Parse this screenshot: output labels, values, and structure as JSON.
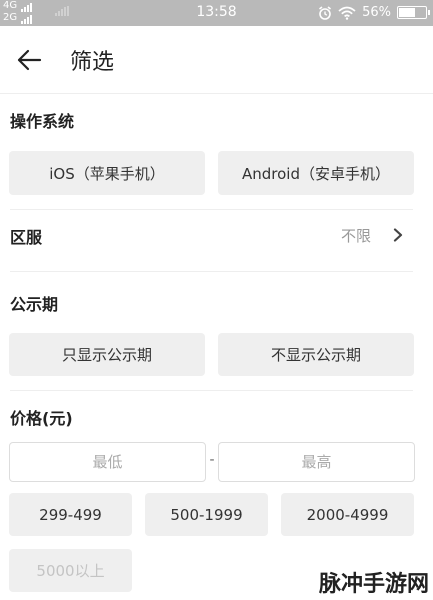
{
  "status_bar": {
    "net1": "4G",
    "net2": "2G",
    "time": "13:58",
    "battery_text": "56%",
    "battery_level": 0.56
  },
  "nav": {
    "title": "筛选",
    "back_icon": "arrow-left"
  },
  "os_section": {
    "title": "操作系统",
    "options": [
      "iOS（苹果手机）",
      "Android（安卓手机）"
    ]
  },
  "region": {
    "label": "区服",
    "value": "不限",
    "chevron_icon": "chevron-right"
  },
  "publicity_section": {
    "title": "公示期",
    "options": [
      "只显示公示期",
      "不显示公示期"
    ]
  },
  "price_section": {
    "title": "价格(元)",
    "min_placeholder": "最低",
    "max_placeholder": "最高",
    "separator": "-",
    "ranges": [
      "299-499",
      "500-1999",
      "2000-4999",
      "5000以上"
    ]
  },
  "watermark": "脉冲手游网",
  "colors": {
    "status_bar_bg": "#b9b9b9",
    "button_bg": "#efefef",
    "disabled_text": "#c4c4c4"
  }
}
